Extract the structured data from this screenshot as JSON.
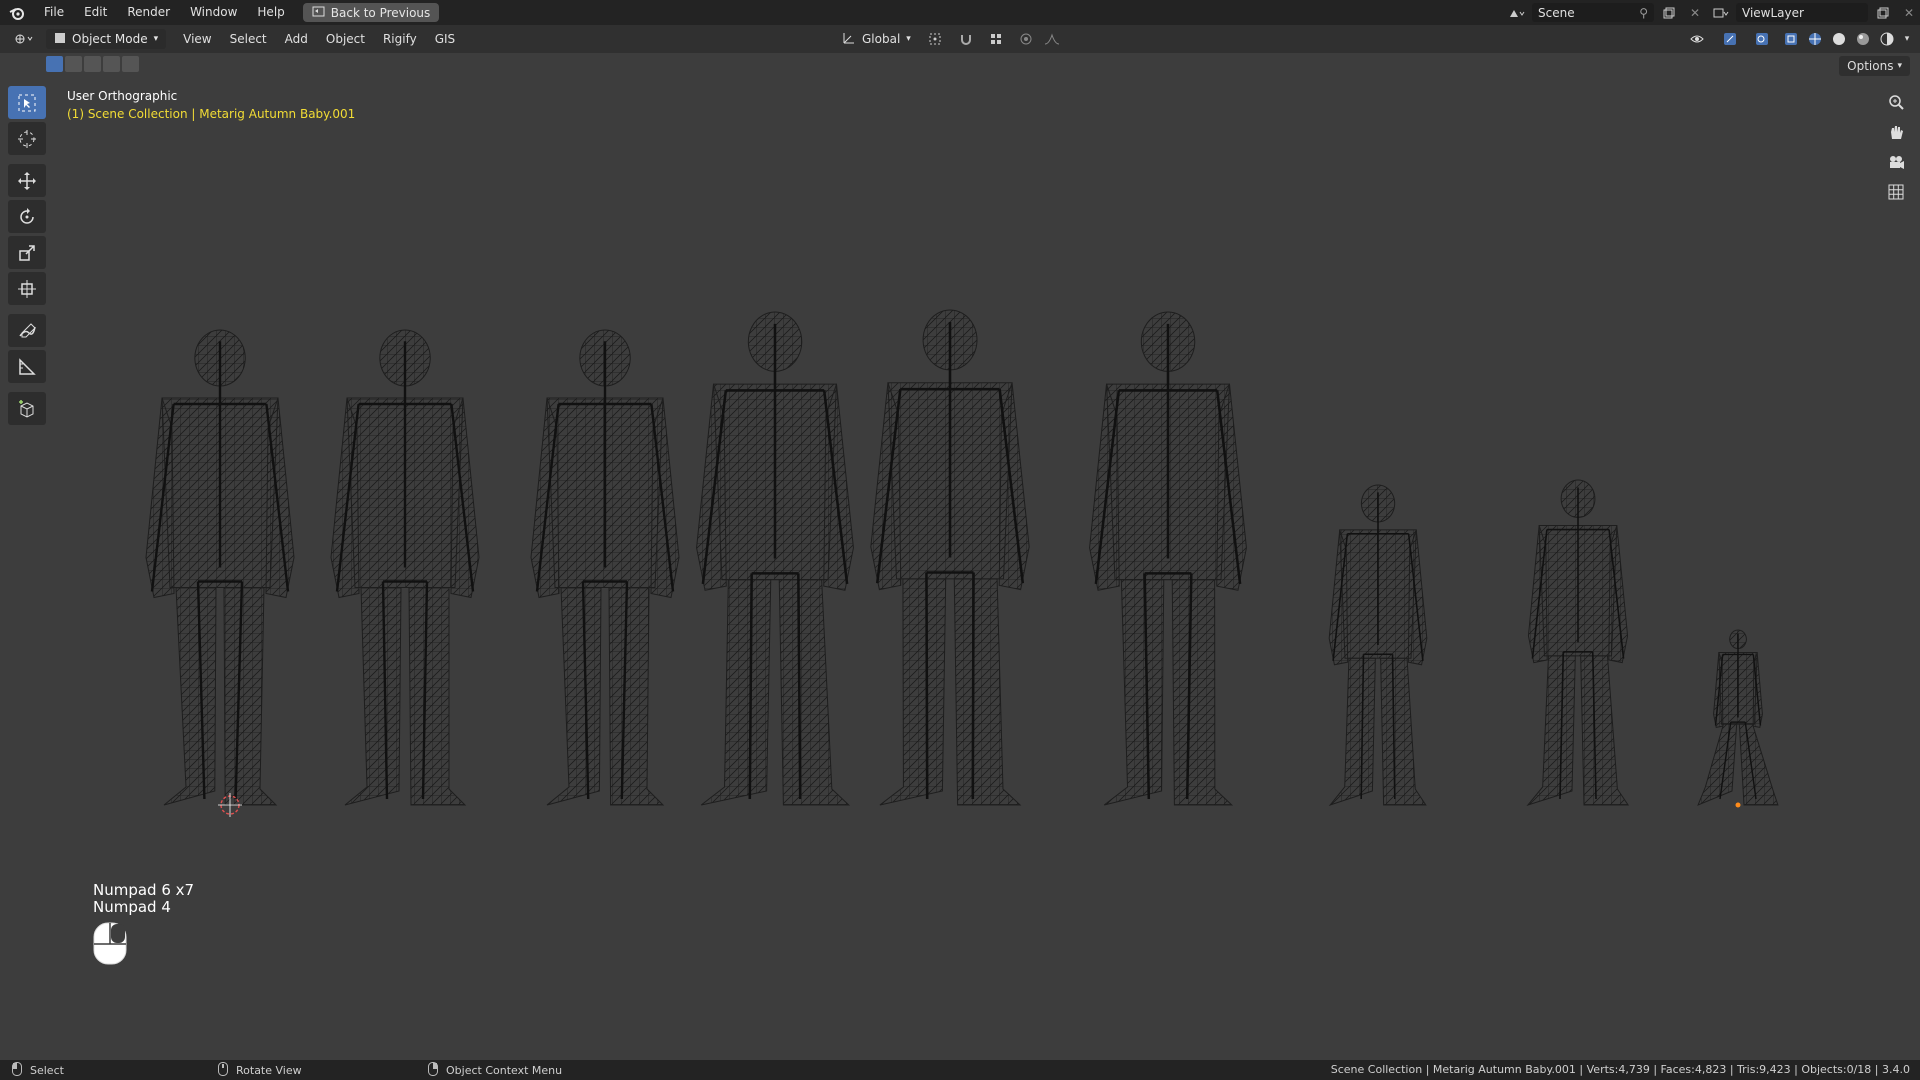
{
  "menubar": {
    "items": [
      "File",
      "Edit",
      "Render",
      "Window",
      "Help"
    ],
    "back_button": "Back to Previous",
    "scene": "Scene",
    "view_layer": "ViewLayer"
  },
  "viewport_header": {
    "mode": "Object Mode",
    "menus": [
      "View",
      "Select",
      "Add",
      "Object",
      "Rigify",
      "GIS"
    ],
    "orientation": "Global",
    "options": "Options"
  },
  "viewport": {
    "view_name": "User Orthographic",
    "collection_info": "(1) Scene Collection | Metarig Autumn Baby.001",
    "key_hints": [
      "Numpad 6 x7",
      "Numpad 4"
    ]
  },
  "toolbar": {
    "tools": [
      "select-box",
      "cursor",
      "move",
      "rotate",
      "scale",
      "transform",
      "annotate",
      "measure",
      "add-cube"
    ],
    "active": "select-box"
  },
  "statusbar": {
    "select": "Select",
    "rotate": "Rotate View",
    "context": "Object Context Menu",
    "stats": "Scene Collection | Metarig Autumn Baby.001 | Verts:4,739 | Faces:4,823 | Tris:9,423 | Objects:0/18 | 3.4.0"
  },
  "colors": {
    "accent": "#4772b3",
    "collection_text": "#f2dc35",
    "background": "#3d3d3d"
  }
}
